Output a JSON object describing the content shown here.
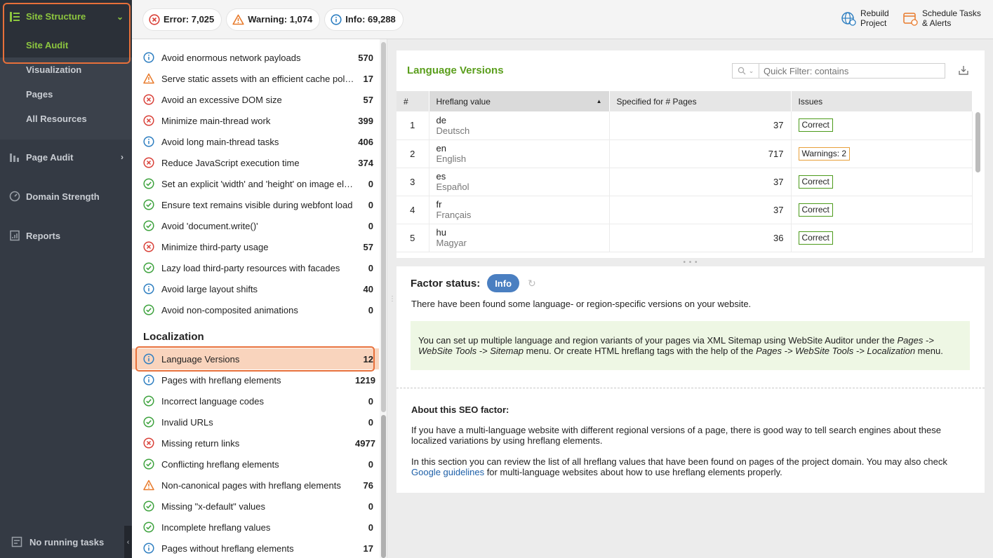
{
  "sidebar": {
    "groups": [
      {
        "label": "Site Structure",
        "icon": "site-structure-icon"
      },
      {
        "label": "Page Audit",
        "icon": "page-audit-icon"
      },
      {
        "label": "Domain Strength",
        "icon": "gauge-icon"
      },
      {
        "label": "Reports",
        "icon": "reports-icon"
      }
    ],
    "site_structure_items": [
      "Site Audit",
      "Visualization",
      "Pages",
      "All Resources"
    ],
    "footer": "No running tasks"
  },
  "topbar": {
    "error": "Error: 7,025",
    "warning": "Warning: 1,074",
    "info": "Info: 69,288",
    "rebuild_line1": "Rebuild",
    "rebuild_line2": "Project",
    "schedule_line1": "Schedule Tasks",
    "schedule_line2": "& Alerts"
  },
  "colors": {
    "accent": "#8dc63f",
    "highlight": "#e8703a",
    "error": "#d9423a",
    "warning": "#e87a2b",
    "info": "#2f7fc1",
    "ok": "#3fa33f"
  },
  "factors_top": [
    {
      "label": "Avoid enormous network payloads",
      "count": "570",
      "status": "info"
    },
    {
      "label": "Serve static assets with an efficient cache policy",
      "count": "17",
      "status": "warning"
    },
    {
      "label": "Avoid an excessive DOM size",
      "count": "57",
      "status": "error"
    },
    {
      "label": "Minimize main-thread work",
      "count": "399",
      "status": "error"
    },
    {
      "label": "Avoid long main-thread tasks",
      "count": "406",
      "status": "info"
    },
    {
      "label": "Reduce JavaScript execution time",
      "count": "374",
      "status": "error"
    },
    {
      "label": "Set an explicit 'width' and 'height' on image elements",
      "count": "0",
      "status": "ok"
    },
    {
      "label": "Ensure text remains visible during webfont load",
      "count": "0",
      "status": "ok"
    },
    {
      "label": "Avoid 'document.write()'",
      "count": "0",
      "status": "ok"
    },
    {
      "label": "Minimize third-party usage",
      "count": "57",
      "status": "error"
    },
    {
      "label": "Lazy load third-party resources with facades",
      "count": "0",
      "status": "ok"
    },
    {
      "label": "Avoid large layout shifts",
      "count": "40",
      "status": "info"
    },
    {
      "label": "Avoid non-composited animations",
      "count": "0",
      "status": "ok"
    }
  ],
  "localization": {
    "title": "Localization",
    "items": [
      {
        "label": "Language Versions",
        "count": "12",
        "status": "info"
      },
      {
        "label": "Pages with hreflang elements",
        "count": "1219",
        "status": "info"
      },
      {
        "label": "Incorrect language codes",
        "count": "0",
        "status": "ok"
      },
      {
        "label": "Invalid URLs",
        "count": "0",
        "status": "ok"
      },
      {
        "label": "Missing return links",
        "count": "4977",
        "status": "error"
      },
      {
        "label": "Conflicting hreflang elements",
        "count": "0",
        "status": "ok"
      },
      {
        "label": "Non-canonical pages with hreflang elements",
        "count": "76",
        "status": "warning"
      },
      {
        "label": "Missing \"x-default\" values",
        "count": "0",
        "status": "ok"
      },
      {
        "label": "Incomplete hreflang values",
        "count": "0",
        "status": "ok"
      },
      {
        "label": "Pages without hreflang elements",
        "count": "17",
        "status": "info"
      }
    ]
  },
  "table": {
    "title": "Language Versions",
    "filter_placeholder": "Quick Filter: contains",
    "columns": [
      "#",
      "Hreflang value",
      "Specified for # Pages",
      "Issues"
    ],
    "rows": [
      {
        "num": "1",
        "code": "de",
        "name": "Deutsch",
        "pages": "37",
        "issue": "Correct",
        "kind": "ok"
      },
      {
        "num": "2",
        "code": "en",
        "name": "English",
        "pages": "717",
        "issue": "Warnings: 2",
        "kind": "warn"
      },
      {
        "num": "3",
        "code": "es",
        "name": "Español",
        "pages": "37",
        "issue": "Correct",
        "kind": "ok"
      },
      {
        "num": "4",
        "code": "fr",
        "name": "Français",
        "pages": "37",
        "issue": "Correct",
        "kind": "ok"
      },
      {
        "num": "5",
        "code": "hu",
        "name": "Magyar",
        "pages": "36",
        "issue": "Correct",
        "kind": "ok"
      }
    ]
  },
  "factor_status": {
    "label": "Factor status:",
    "badge": "Info",
    "description": "There have been found some language- or region-specific versions on your website.",
    "tip": {
      "t1": "You can set up multiple language and region variants of your pages via XML Sitemap using WebSite Auditor under the ",
      "t2": "Pages -> WebSite Tools -> Sitemap",
      "t3": " menu. Or create HTML hreflang tags with the help of the ",
      "t4": "Pages -> WebSite Tools -> Localization",
      "t5": " menu."
    },
    "about_title": "About this SEO factor:",
    "about_p1": "If you have a multi-language website with different regional versions of a page, there is good way to tell search engines about these localized variations by using hreflang elements.",
    "about_p2_a": "In this section you can review the list of all hreflang values that have been found on pages of the project domain. You may also check ",
    "about_link": "Google guidelines",
    "about_p2_b": " for multi-language websites about how to use hreflang elements properly."
  }
}
